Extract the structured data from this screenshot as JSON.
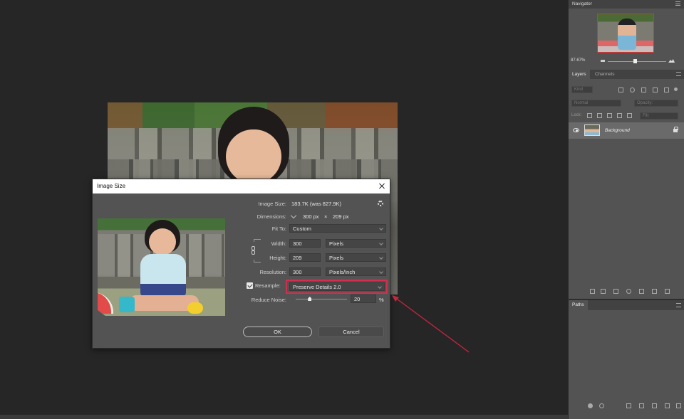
{
  "navigator": {
    "title": "Navigator",
    "zoom": "87.67%"
  },
  "layers": {
    "tabs": [
      "Layers",
      "Channels"
    ],
    "search_placeholder": "Kind",
    "blend_mode": "Normal",
    "opacity_label": "Opacity:",
    "lock_label": "Lock:",
    "fill_label": "Fill:",
    "layer_name": "Background"
  },
  "paths": {
    "title": "Paths"
  },
  "dialog": {
    "title": "Image Size",
    "image_size_label": "Image Size:",
    "image_size_value": "183.7K (was 827.9K)",
    "dimensions_label": "Dimensions:",
    "dimensions_w": "300 px",
    "dimensions_x": "×",
    "dimensions_h": "209 px",
    "fit_to_label": "Fit To:",
    "fit_to_value": "Custom",
    "width_label": "Width:",
    "width_value": "300",
    "width_unit": "Pixels",
    "height_label": "Height:",
    "height_value": "209",
    "height_unit": "Pixels",
    "resolution_label": "Resolution:",
    "resolution_value": "300",
    "resolution_unit": "Pixels/Inch",
    "resample_label": "Resample:",
    "resample_value": "Preserve Details 2.0",
    "reduce_noise_label": "Reduce Noise:",
    "reduce_noise_value": "20",
    "reduce_noise_unit": "%",
    "reduce_noise_level_percent": 20,
    "ok_label": "OK",
    "cancel_label": "Cancel"
  },
  "colors": {
    "highlight": "#d12f4d",
    "arrow": "#c8253f"
  }
}
